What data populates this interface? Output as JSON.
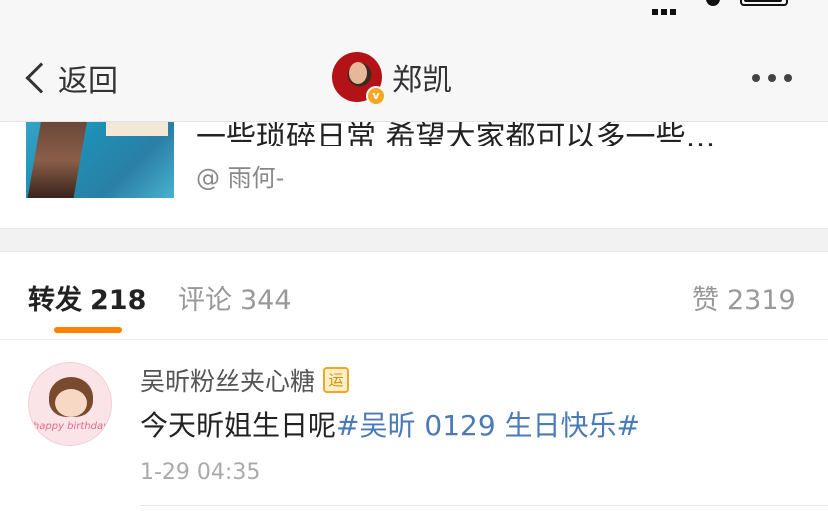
{
  "nav": {
    "back_label": "返回",
    "title": "郑凯",
    "verified_badge": "v"
  },
  "embedded_post": {
    "text": "一些琐碎日常 希望大家都可以多一些…",
    "author": "@ 雨何-"
  },
  "tabs": [
    {
      "label": "转发",
      "count": "218",
      "active": true
    },
    {
      "label": "评论",
      "count": "344",
      "active": false
    },
    {
      "label": "赞",
      "count": "2319",
      "active": false
    }
  ],
  "repost": {
    "user_name": "吴昕粉丝夹心糖",
    "user_badge": "运",
    "avatar_caption": "happy birthday",
    "text": "今天昕姐生日呢",
    "topic": "#吴昕 0129 生日快乐#",
    "time": "1-29 04:35"
  },
  "colors": {
    "accent": "#ff8200",
    "link": "#4a7ab8",
    "nav_bg": "#f7f7f7",
    "badge": "#f5a623"
  }
}
